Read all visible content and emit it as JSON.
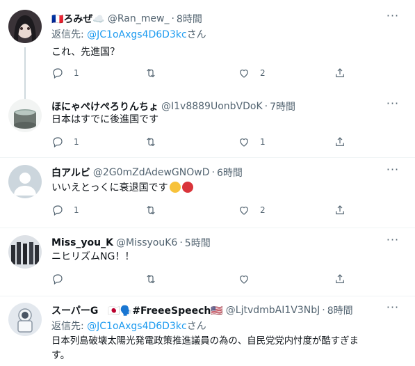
{
  "colors": {
    "link": "#1d9bf0",
    "secondary": "#536471",
    "text": "#0f1419",
    "divider": "#eff3f4"
  },
  "tweets": [
    {
      "name": "🇫🇷ろみぜ☁️",
      "handle": "@Ran_mew_",
      "time": "8時間",
      "reply_prefix": "返信先: ",
      "reply_mention": "@JC1oAxgs4D6D3kc",
      "reply_suffix": "さん",
      "text": "これ、先進国？",
      "replies": "1",
      "retweets": "",
      "likes": "2"
    },
    {
      "name": "ほにゃぺけぺろりんちょ",
      "handle": "@I1v8889UonbVDoK",
      "time": "7時間",
      "text": "日本はすでに後進国です",
      "replies": "1",
      "retweets": "",
      "likes": "1"
    },
    {
      "name": "白アルビ",
      "handle": "@2G0mZdAdewGNOwD",
      "time": "6時間",
      "text": "いいえとっくに衰退国です",
      "replies": "1",
      "retweets": "",
      "likes": "2"
    },
    {
      "name": "Miss_you_K",
      "handle": "@MissyouK6",
      "time": "5時間",
      "text": "ニヒリズムNG！！",
      "replies": "",
      "retweets": "",
      "likes": ""
    },
    {
      "name": "スーパーG　🇯🇵🗣️#FreeeSpeech🇺🇸",
      "handle": "@LjtvdmbAI1V3NbJ",
      "time": "8時間",
      "reply_prefix": "返信先: ",
      "reply_mention": "@JC1oAxgs4D6D3kc",
      "reply_suffix": "さん",
      "text_line1": "日本列島破壊太陽光発電政策推進議員の為の、自民党党内忖度が酷すぎま",
      "text_line2": "す。"
    }
  ],
  "icons": {
    "reply": "reply-icon",
    "retweet": "retweet-icon",
    "like": "heart-icon",
    "share": "share-icon",
    "more": "more-icon"
  }
}
